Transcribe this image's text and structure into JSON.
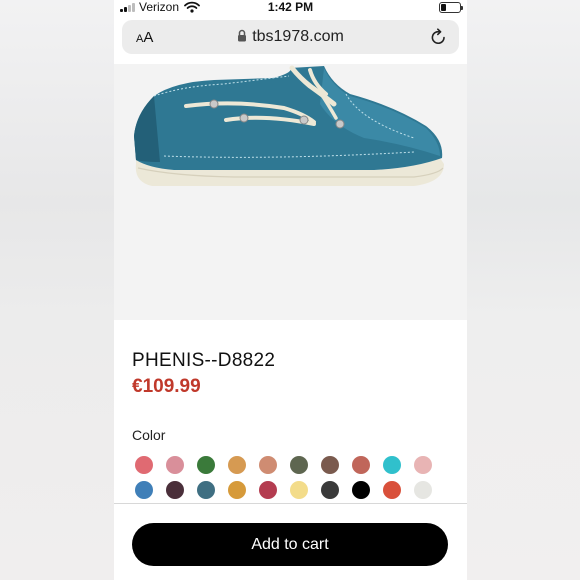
{
  "status_bar": {
    "carrier": "Verizon",
    "time": "1:42 PM"
  },
  "browser": {
    "text_size_label": "AA",
    "url": "tbs1978.com"
  },
  "product": {
    "name": "PHENIS--D8822",
    "price": "€109.99",
    "color_label": "Color",
    "swatches": [
      "#e06a72",
      "#d98f9a",
      "#3a7a3a",
      "#d69a52",
      "#cf8c72",
      "#5e6650",
      "#7a5a4e",
      "#c0665a",
      "#30c0cc",
      "#e8b4b4",
      "#3f7fb8",
      "#4a2f3a",
      "#3f6f82",
      "#d69a3a",
      "#b43c50",
      "#f3dc8a",
      "#3a3a3a",
      "#000000",
      "#d9503a",
      "#e6e6e2"
    ]
  },
  "cart": {
    "button_label": "Add to cart"
  }
}
